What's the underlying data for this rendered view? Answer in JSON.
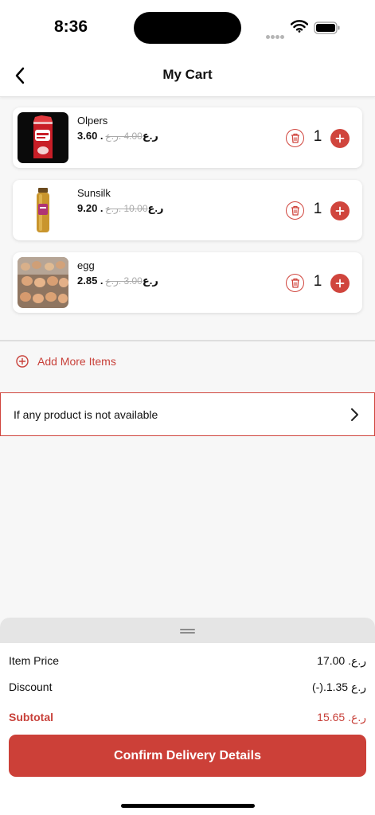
{
  "status_bar": {
    "time": "8:36"
  },
  "nav": {
    "title": "My Cart"
  },
  "cart": {
    "items": [
      {
        "name": "Olpers",
        "price": "3.60 .ر.ع",
        "old_price": "4.00 .ر.ع",
        "quantity": "1",
        "image": "milk-carton-image"
      },
      {
        "name": "Sunsilk",
        "price": "9.20 .ر.ع",
        "old_price": "10.00 .ر.ع",
        "quantity": "1",
        "image": "shampoo-bottle-image"
      },
      {
        "name": "egg",
        "price": "2.85 .ر.ع",
        "old_price": "3.00 .ر.ع",
        "quantity": "1",
        "image": "egg-tray-image"
      }
    ]
  },
  "add_more": {
    "label": "Add More Items"
  },
  "availability": {
    "label": "If any product is not available"
  },
  "summary": {
    "item_price_label": "Item Price",
    "item_price_value": "17.00 .ر.ع",
    "discount_label": "Discount",
    "discount_value": "(-).ر.ع 1.35",
    "subtotal_label": "Subtotal",
    "subtotal_value": "15.65 .ر.ع"
  },
  "confirm": {
    "label": "Confirm Delivery Details"
  },
  "colors": {
    "accent": "#cc4038",
    "background": "#f7f7f7"
  }
}
